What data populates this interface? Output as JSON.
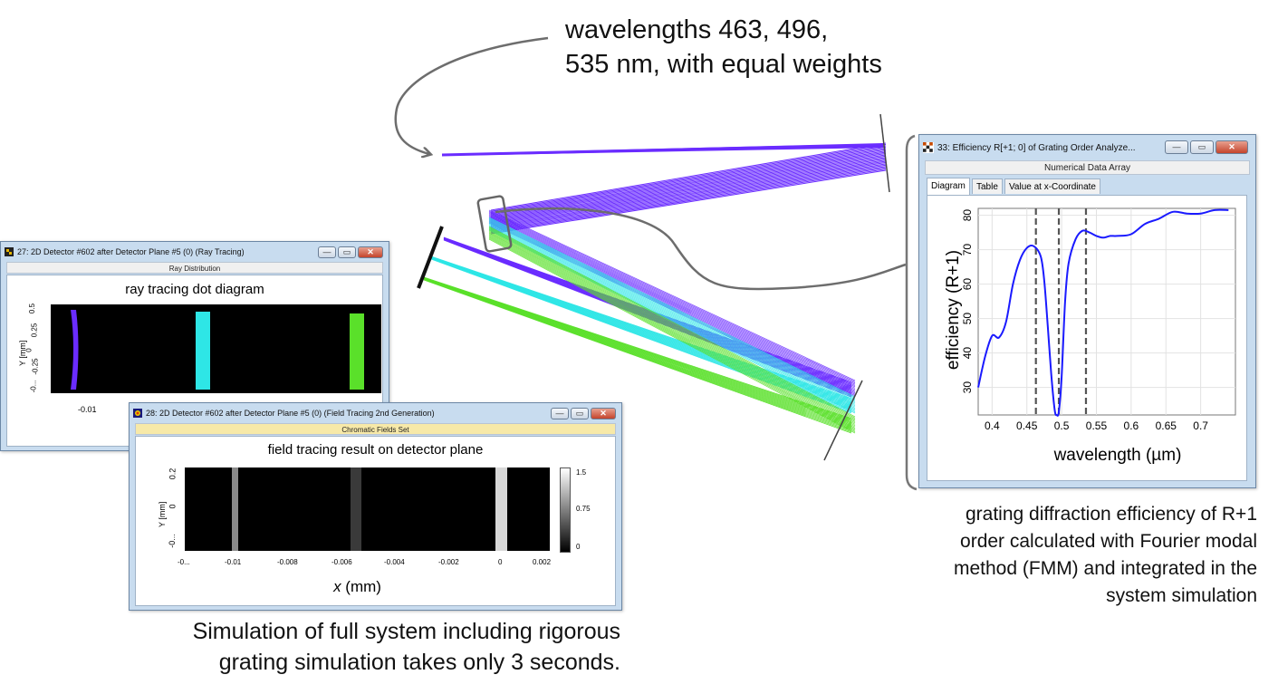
{
  "annotations": {
    "wavelengths_line1": "wavelengths 463, 496,",
    "wavelengths_line2": "535 nm, with equal weights",
    "grating_line1": "grating diffraction efficiency of R+1",
    "grating_line2": "order calculated with Fourier modal",
    "grating_line3": "method (FMM) and integrated in the",
    "grating_line4": "system simulation",
    "sim_line1": "Simulation of full system including rigorous",
    "sim_line2": "grating simulation takes only 3 seconds."
  },
  "colors": {
    "violet": "#6a2cff",
    "cyan": "#2ee6e6",
    "green": "#5ae02a",
    "window_bg": "#c8dcef",
    "plot_line": "#1a1aff"
  },
  "window_ray": {
    "title": "27: 2D Detector #602 after Detector Plane #5 (0) (Ray Tracing)",
    "subtitle": "Ray Distribution",
    "plot_title": "ray tracing dot diagram",
    "ylabel": "Y [mm]",
    "yticks": [
      "0.5",
      "0.25",
      "0",
      "-0.25",
      "-0..."
    ],
    "xticks": [
      "-0.01"
    ]
  },
  "window_field": {
    "title": "28: 2D Detector #602 after Detector Plane #5 (0) (Field Tracing 2nd Generation)",
    "subtitle": "Chromatic Fields Set",
    "plot_title": "field tracing result on detector plane",
    "ylabel": "Y [mm]",
    "yticks": [
      "0.2",
      "0",
      "-0..."
    ],
    "xticks": [
      "-0...",
      "-0.01",
      "-0.008",
      "-0.006",
      "-0.004",
      "-0.002",
      "0",
      "0.002"
    ],
    "xlabel_var": "x",
    "xlabel_unit": " (mm)",
    "colorbar_ticks": [
      "1.5",
      "0.75",
      "0"
    ]
  },
  "window_eff": {
    "title": "33: Efficiency R[+1; 0] of Grating Order Analyze...",
    "subtitle": "Numerical Data Array",
    "tabs": [
      "Diagram",
      "Table",
      "Value at x-Coordinate"
    ],
    "active_tab": 0,
    "btn_min": "—",
    "btn_max": "▭",
    "btn_close": "✕"
  },
  "chart_data": {
    "type": "line",
    "xlabel": "wavelength  (µm)",
    "ylabel": "efficiency (R+1)",
    "xlim": [
      0.38,
      0.75
    ],
    "ylim": [
      22,
      82
    ],
    "xticks": [
      0.4,
      0.45,
      0.5,
      0.55,
      0.6,
      0.65,
      0.7
    ],
    "yticks": [
      30,
      40,
      50,
      60,
      70,
      80
    ],
    "xtick_labels": [
      "0.4",
      "0.45",
      "0.5",
      "0.55",
      "0.6",
      "0.65",
      "0.7"
    ],
    "ytick_labels": [
      "30",
      "40",
      "50",
      "60",
      "70",
      "80"
    ],
    "vlines": [
      0.463,
      0.496,
      0.535
    ],
    "grid": true,
    "series": [
      {
        "x": [
          0.38,
          0.39,
          0.4,
          0.41,
          0.42,
          0.43,
          0.44,
          0.45,
          0.46,
          0.47,
          0.475,
          0.48,
          0.485,
          0.49,
          0.493,
          0.496,
          0.5,
          0.505,
          0.51,
          0.52,
          0.53,
          0.54,
          0.55,
          0.56,
          0.57,
          0.58,
          0.6,
          0.62,
          0.64,
          0.66,
          0.68,
          0.7,
          0.72,
          0.74
        ],
        "y": [
          30,
          39,
          45,
          44.5,
          49,
          60,
          67,
          70.5,
          71,
          68,
          61,
          48,
          34,
          23.5,
          22,
          23,
          33,
          55,
          66,
          73,
          75.5,
          75,
          74,
          73.5,
          74,
          74,
          74.5,
          77.5,
          79,
          81,
          80.5,
          80.5,
          81.5,
          81.5
        ]
      }
    ]
  }
}
